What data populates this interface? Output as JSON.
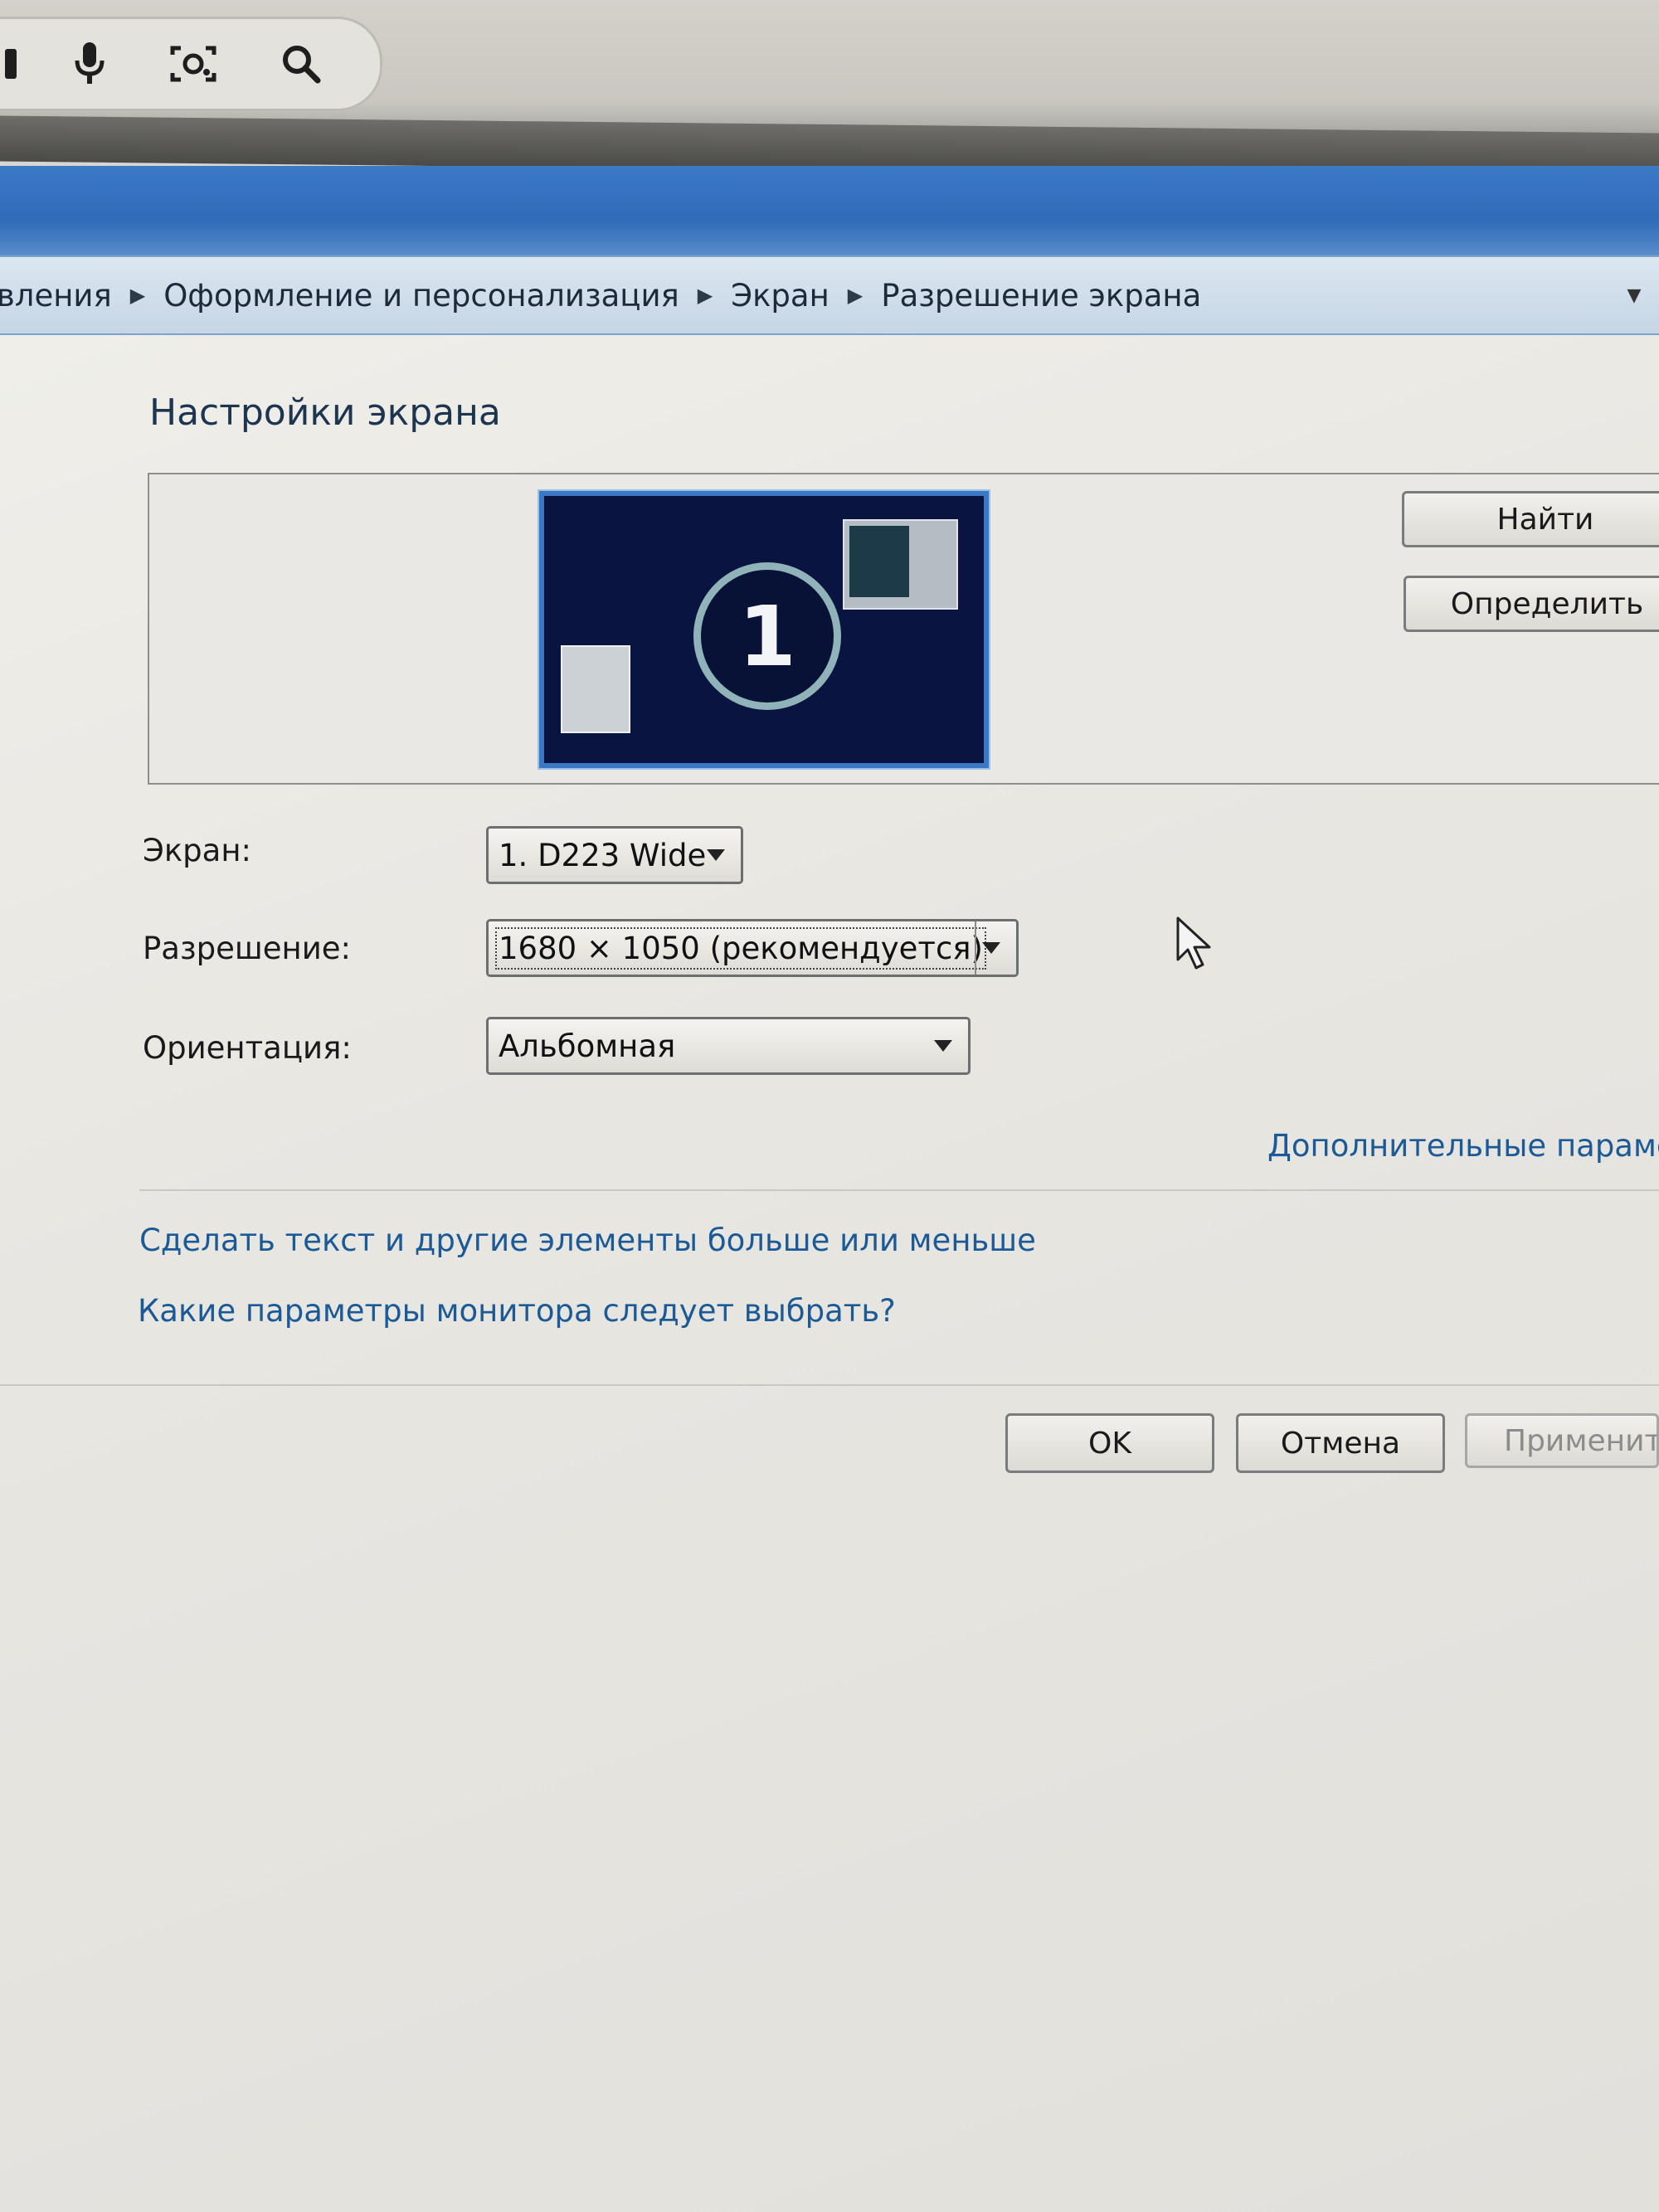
{
  "window": {
    "breadcrumb": [
      {
        "label": "вления"
      },
      {
        "label": "Оформление и персонализация"
      },
      {
        "label": "Экран"
      },
      {
        "label": "Разрешение экрана"
      }
    ]
  },
  "page": {
    "title": "Настройки экрана",
    "preview": {
      "monitor_number": "1",
      "buttons": {
        "find_label": "Найти",
        "identify_label": "Определить"
      }
    },
    "fields": {
      "display": {
        "label": "Экран:",
        "value": "1. D223 Wide"
      },
      "resolution": {
        "label": "Разрешение:",
        "value": "1680 × 1050 (рекомендуется)"
      },
      "orientation": {
        "label": "Ориентация:",
        "value": "Альбомная"
      }
    },
    "advanced_link": "Дополнительные параме",
    "links": {
      "text_size": "Сделать текст и другие элементы больше или меньше",
      "which_settings": "Какие параметры монитора следует выбрать?"
    },
    "footer": {
      "ok_label": "OK",
      "cancel_label": "Отмена",
      "apply_label": "Применит"
    }
  },
  "colors": {
    "titlebar": "#2f6bb8",
    "link": "#1b5a96",
    "monitor_bg": "#0a1440",
    "monitor_border": "#3a78c4"
  },
  "icons": [
    "microphone-icon",
    "camera-search-icon",
    "search-icon",
    "chevron-right-icon",
    "dropdown-arrow-icon",
    "mouse-cursor-icon"
  ]
}
